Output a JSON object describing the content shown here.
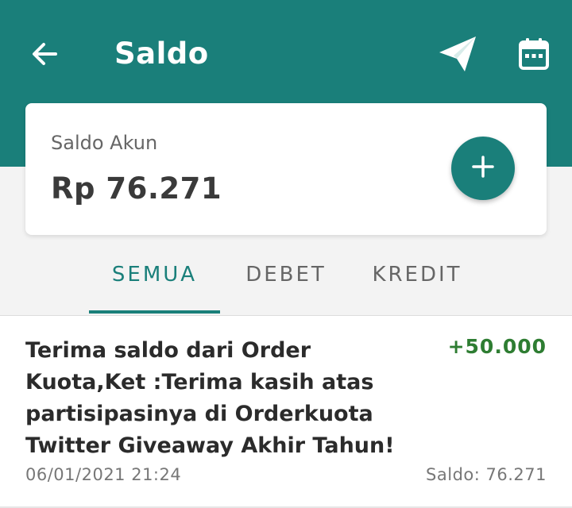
{
  "header": {
    "title": "Saldo",
    "back_icon": "arrow-left-icon",
    "send_icon": "paper-plane-icon",
    "calendar_icon": "calendar-icon",
    "bg_color": "#1a7f7a"
  },
  "balance_card": {
    "label": "Saldo Akun",
    "amount": "Rp 76.271",
    "add_icon": "plus-icon"
  },
  "tabs": [
    {
      "label": "SEMUA",
      "active": true
    },
    {
      "label": "DEBET",
      "active": false
    },
    {
      "label": "KREDIT",
      "active": false
    }
  ],
  "transactions": [
    {
      "description": "Terima saldo dari Order Kuota,Ket :Terima kasih atas partisipasinya di Orderkuota Twitter Giveaway Akhir Tahun!",
      "amount": "+50.000",
      "date": "06/01/2021 21:24",
      "balance": "Saldo: 76.271"
    }
  ],
  "colors": {
    "accent": "#1a7f7a",
    "credit": "#2e7d32"
  }
}
